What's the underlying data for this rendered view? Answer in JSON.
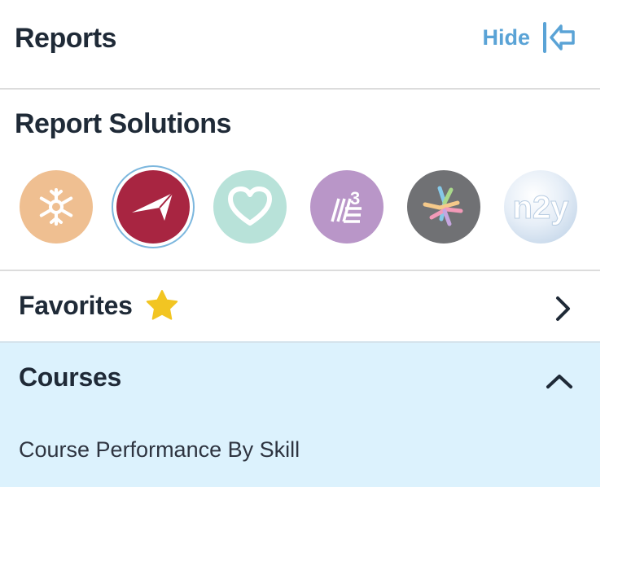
{
  "header": {
    "title": "Reports",
    "hide_label": "Hide"
  },
  "report_solutions": {
    "title": "Report Solutions",
    "items": [
      {
        "icon": "snowflake-icon",
        "color": "#efbf91"
      },
      {
        "icon": "paper-plane-icon",
        "color": "#a82541",
        "selected": true
      },
      {
        "icon": "heart-icon",
        "color": "#b8e2d9"
      },
      {
        "icon": "m3-logo-icon",
        "color": "#b996c8",
        "text": "3"
      },
      {
        "icon": "colorful-knot-icon",
        "color": "#707174"
      },
      {
        "icon": "n2y-globe-icon",
        "color": "#d9e6f3",
        "text": "n2y"
      }
    ]
  },
  "favorites": {
    "label": "Favorites",
    "star_color": "#f2c522"
  },
  "courses": {
    "label": "Courses",
    "expanded": true,
    "items": [
      {
        "label": "Course Performance By Skill"
      }
    ]
  },
  "colors": {
    "accent": "#5aa3d6",
    "active_bg": "#dcf2fd",
    "text": "#1f2a37"
  }
}
